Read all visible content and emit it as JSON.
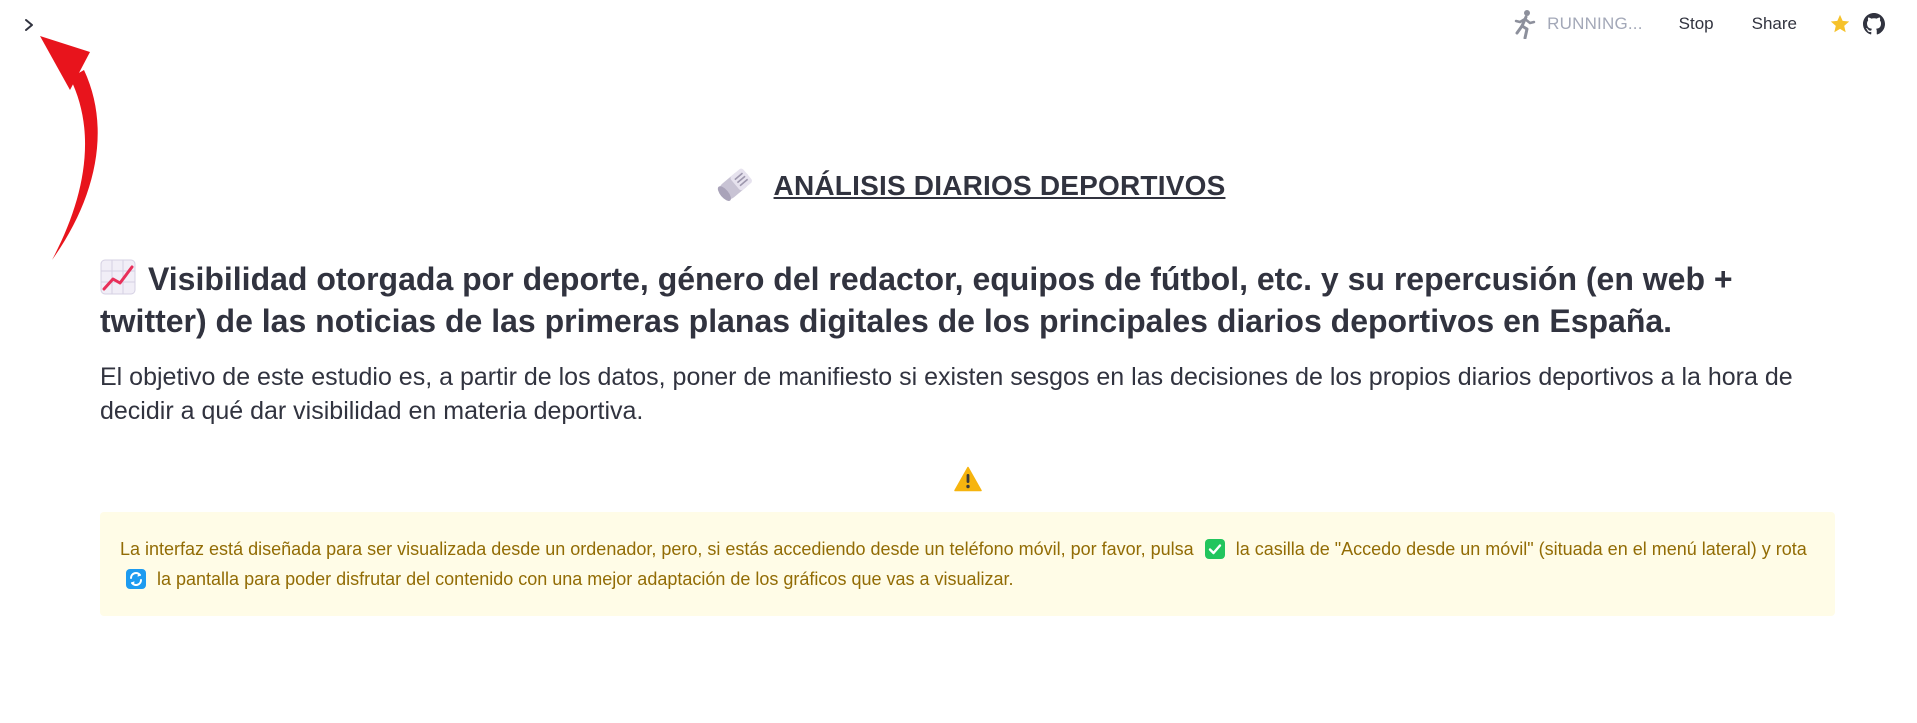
{
  "header": {
    "status_text": "RUNNING...",
    "stop_label": "Stop",
    "share_label": "Share"
  },
  "main": {
    "title": "ANÁLISIS DIARIOS DEPORTIVOS",
    "headline": "Visibilidad otorgada por deporte, género del redactor, equipos de fútbol, etc. y su repercusión (en web + twitter) de las noticias de las primeras planas digitales de los principales diarios deportivos en España.",
    "lead": "El objetivo de este estudio es, a partir de los datos, poner de manifiesto si existen sesgos en las decisiones de los propios diarios deportivos a la hora de decidir a qué dar visibilidad en materia deportiva.",
    "info_part1": "La interfaz está diseñada para ser visualizada desde un ordenador, pero, si estás accediendo desde un teléfono móvil, por favor, pulsa",
    "info_part2": "la casilla de \"Accedo desde un móvil\" (situada en el menú lateral) y rota",
    "info_part3": "la pantalla para poder disfrutar del contenido con una mejor adaptación de los gráficos que vas a visualizar."
  },
  "colors": {
    "accent_red": "#e8141c",
    "info_bg": "#fffce7",
    "info_text": "#926c05",
    "star": "#f6c22b"
  },
  "icons": [
    "chevron-right-icon",
    "running-man-icon",
    "star-icon",
    "github-icon",
    "newspaper-icon",
    "chart-increasing-icon",
    "warning-icon",
    "check-mark-icon",
    "rotate-icon"
  ]
}
